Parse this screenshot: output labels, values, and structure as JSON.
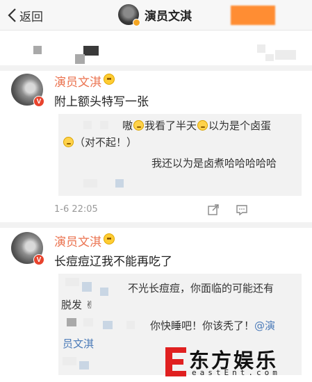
{
  "topbar": {
    "back_label": "返回",
    "title": "演员文淇"
  },
  "posts": [
    {
      "username": "演员文淇",
      "text": "附上额头特写一张",
      "replies": [
        {
          "line1": "嗷",
          "mid1": "我看了半天",
          "mid2": "以为是个卤蛋",
          "line2": "（对不起！）"
        },
        {
          "text": "我还以为是卤煮哈哈哈哈哈"
        }
      ],
      "time": "1-6 22:05"
    },
    {
      "username": "演员文淇",
      "text": "长痘痘辽我不能再吃了",
      "replies": [
        {
          "line1": "不光长痘痘，你面临的可能还有",
          "line2": "脱发 ✌"
        },
        {
          "line1": "你快睡吧！你该秃了！",
          "mention": "@演",
          "mention2": "员文淇"
        }
      ]
    }
  ],
  "watermark": {
    "cn": "东方娱乐",
    "en": "eastEnt.com"
  },
  "colors": {
    "username": "#eb7350",
    "mention": "#4a7ab8",
    "orange_block": "#ff8d33",
    "watermark_red": "#e02020"
  },
  "icons": [
    "chevron-left-icon",
    "verified-badge-icon",
    "emoji-icon",
    "share-icon",
    "comment-icon"
  ]
}
